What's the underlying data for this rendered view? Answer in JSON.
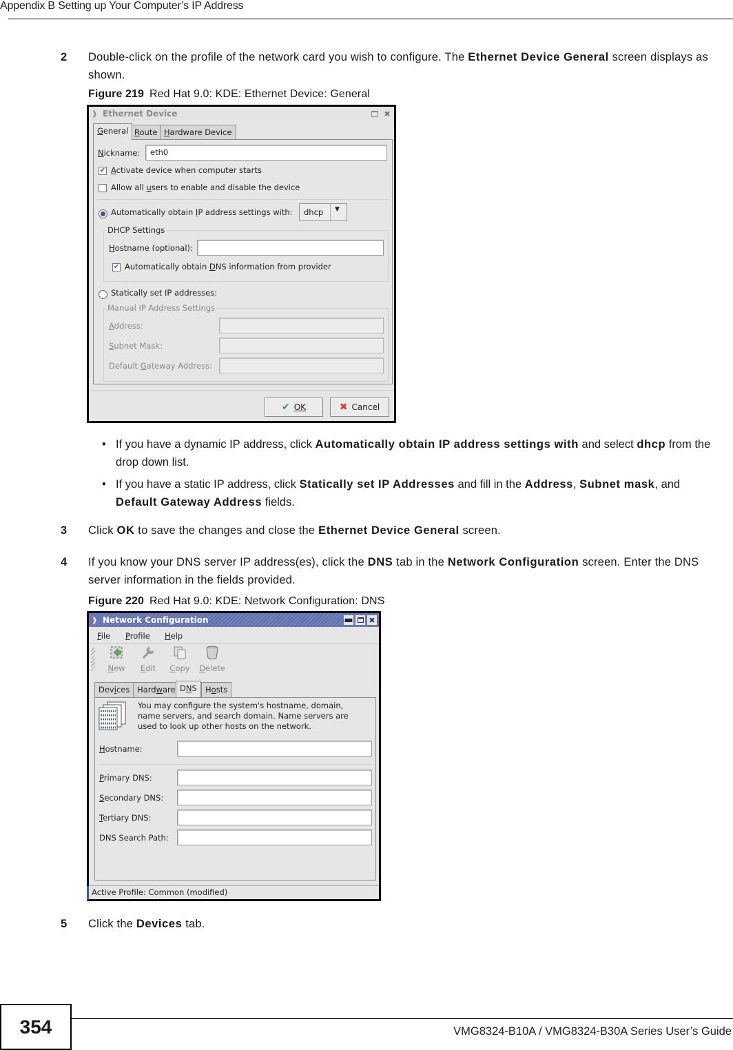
{
  "page": {
    "running_header": "Appendix B Setting up Your Computer’s IP Address",
    "page_number": "354",
    "footer_title": "VMG8324-B10A / VMG8324-B30A Series User’s Guide"
  },
  "steps": [
    {
      "number": "2",
      "parts": [
        "Double-click on the profile of the network card you wish to configure. The ",
        "Ethernet Device General",
        " screen displays as shown."
      ]
    },
    {
      "number": "3",
      "parts": [
        "Click ",
        "OK",
        " to save the changes and close the ",
        "Ethernet Device General",
        " screen."
      ]
    },
    {
      "number": "4",
      "parts": [
        "If you know your DNS server IP address(es), click the ",
        "DNS",
        " tab in the ",
        "Network Configuration",
        " screen. Enter the DNS server information in the fields provided."
      ]
    },
    {
      "number": "5",
      "parts": [
        "Click the ",
        "Devices",
        " tab."
      ]
    }
  ],
  "bullets": [
    {
      "parts": [
        "If you have a dynamic IP address, click ",
        "Automatically obtain IP address settings with",
        " and select ",
        "dhcp",
        " from the drop down list."
      ]
    },
    {
      "parts": [
        "If you have a static IP address, click ",
        "Statically set IP Addresses",
        " and fill in the  ",
        "Address",
        ", ",
        "Subnet mask",
        ", and ",
        "Default Gateway Address",
        " fields."
      ]
    }
  ],
  "figures": {
    "fig219": {
      "number": "Figure 219",
      "caption": "Red Hat 9.0: KDE: Ethernet Device: General"
    },
    "fig220": {
      "number": "Figure 220",
      "caption": "Red Hat 9.0: KDE: Network Configuration: DNS"
    }
  },
  "ethernet_dialog": {
    "title": "Ethernet Device",
    "tabs": [
      "General",
      "Route",
      "Hardware Device"
    ],
    "active_tab": "General",
    "nickname_label": "Nickname:",
    "nickname_value": "eth0",
    "activate_on_start_label": "Activate device when computer starts",
    "activate_on_start_checked": true,
    "allow_users_label": "Allow all users to enable and disable the device",
    "allow_users_checked": false,
    "auto_ip_label": "Automatically obtain IP address settings with:",
    "auto_ip_selected": true,
    "auto_ip_method": "dhcp",
    "dhcp_group_label": "DHCP Settings",
    "hostname_label": "Hostname (optional):",
    "hostname_value": "",
    "auto_dns_label": "Automatically obtain DNS information from provider",
    "auto_dns_checked": true,
    "static_ip_label": "Statically set IP addresses:",
    "static_ip_selected": false,
    "manual_group_label": "Manual IP Address Settings",
    "address_label": "Address:",
    "subnet_label": "Subnet Mask:",
    "gateway_label": "Default Gateway Address:",
    "ok_label": "OK",
    "cancel_label": "Cancel"
  },
  "network_dialog": {
    "title": "Network Configuration",
    "menu": [
      "File",
      "Profile",
      "Help"
    ],
    "toolbar": [
      {
        "label": "New",
        "icon": "new-icon"
      },
      {
        "label": "Edit",
        "icon": "wrench-icon"
      },
      {
        "label": "Copy",
        "icon": "copy-icon"
      },
      {
        "label": "Delete",
        "icon": "trash-icon"
      }
    ],
    "tabs": [
      "Devices",
      "Hardware",
      "DNS",
      "Hosts"
    ],
    "active_tab": "DNS",
    "description": "You may configure the system's hostname, domain, name servers, and search domain. Name servers are used to look up other hosts on the network.",
    "hostname_label": "Hostname:",
    "primary_dns_label": "Primary DNS:",
    "secondary_dns_label": "Secondary DNS:",
    "tertiary_dns_label": "Tertiary DNS:",
    "search_path_label": "DNS Search Path:",
    "status": "Active Profile: Common (modified)"
  },
  "colors": {
    "kde_title_active": "#6a79b6",
    "checkbox_mark": "#3857a8",
    "ok_icon": "#3e9a3a",
    "cancel_icon": "#d9402c"
  }
}
